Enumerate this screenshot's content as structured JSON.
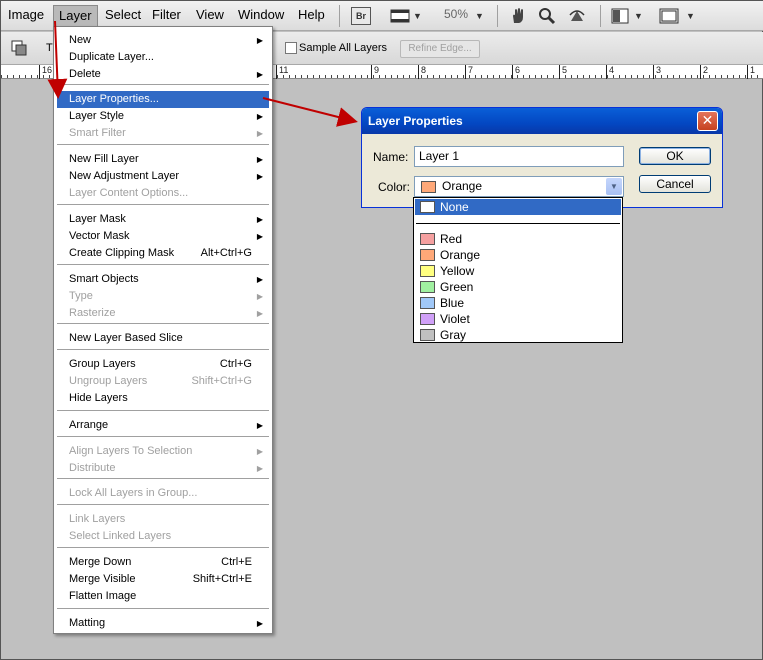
{
  "menubar": {
    "items": [
      "Image",
      "Layer",
      "Select",
      "Filter",
      "View",
      "Window",
      "Help"
    ],
    "br_label": "Br",
    "zoom": "50%"
  },
  "options_bar": {
    "t_label": "T",
    "sample_all_layers": "Sample All Layers",
    "refine_edge": "Refine Edge..."
  },
  "ruler": {
    "ticks": [
      "16",
      "11",
      "9",
      "8",
      "7",
      "6",
      "5",
      "4",
      "3",
      "2",
      "1"
    ]
  },
  "layer_menu": {
    "items": [
      {
        "label": "New",
        "shortcut": "",
        "submenu": true,
        "disabled": false
      },
      {
        "label": "Duplicate Layer...",
        "shortcut": "",
        "submenu": false,
        "disabled": false
      },
      {
        "label": "Delete",
        "shortcut": "",
        "submenu": true,
        "disabled": false
      },
      {
        "label": "Layer Properties...",
        "shortcut": "",
        "submenu": false,
        "disabled": false,
        "highlight": true
      },
      {
        "label": "Layer Style",
        "shortcut": "",
        "submenu": true,
        "disabled": false
      },
      {
        "label": "Smart Filter",
        "shortcut": "",
        "submenu": true,
        "disabled": true
      },
      {
        "label": "New Fill Layer",
        "shortcut": "",
        "submenu": true,
        "disabled": false
      },
      {
        "label": "New Adjustment Layer",
        "shortcut": "",
        "submenu": true,
        "disabled": false
      },
      {
        "label": "Layer Content Options...",
        "shortcut": "",
        "submenu": false,
        "disabled": true
      },
      {
        "label": "Layer Mask",
        "shortcut": "",
        "submenu": true,
        "disabled": false
      },
      {
        "label": "Vector Mask",
        "shortcut": "",
        "submenu": true,
        "disabled": false
      },
      {
        "label": "Create Clipping Mask",
        "shortcut": "Alt+Ctrl+G",
        "submenu": false,
        "disabled": false
      },
      {
        "label": "Smart Objects",
        "shortcut": "",
        "submenu": true,
        "disabled": false
      },
      {
        "label": "Type",
        "shortcut": "",
        "submenu": true,
        "disabled": true
      },
      {
        "label": "Rasterize",
        "shortcut": "",
        "submenu": true,
        "disabled": true
      },
      {
        "label": "New Layer Based Slice",
        "shortcut": "",
        "submenu": false,
        "disabled": false
      },
      {
        "label": "Group Layers",
        "shortcut": "Ctrl+G",
        "submenu": false,
        "disabled": false
      },
      {
        "label": "Ungroup Layers",
        "shortcut": "Shift+Ctrl+G",
        "submenu": false,
        "disabled": true
      },
      {
        "label": "Hide Layers",
        "shortcut": "",
        "submenu": false,
        "disabled": false
      },
      {
        "label": "Arrange",
        "shortcut": "",
        "submenu": true,
        "disabled": false
      },
      {
        "label": "Align Layers To Selection",
        "shortcut": "",
        "submenu": true,
        "disabled": true
      },
      {
        "label": "Distribute",
        "shortcut": "",
        "submenu": true,
        "disabled": true
      },
      {
        "label": "Lock All Layers in Group...",
        "shortcut": "",
        "submenu": false,
        "disabled": true
      },
      {
        "label": "Link Layers",
        "shortcut": "",
        "submenu": false,
        "disabled": true
      },
      {
        "label": "Select Linked Layers",
        "shortcut": "",
        "submenu": false,
        "disabled": true
      },
      {
        "label": "Merge Down",
        "shortcut": "Ctrl+E",
        "submenu": false,
        "disabled": false
      },
      {
        "label": "Merge Visible",
        "shortcut": "Shift+Ctrl+E",
        "submenu": false,
        "disabled": false
      },
      {
        "label": "Flatten Image",
        "shortcut": "",
        "submenu": false,
        "disabled": false
      },
      {
        "label": "Matting",
        "shortcut": "",
        "submenu": true,
        "disabled": false
      }
    ]
  },
  "dialog": {
    "title": "Layer Properties",
    "name_label": "Name:",
    "name_value": "Layer 1",
    "color_label": "Color:",
    "color_value": "Orange",
    "ok": "OK",
    "cancel": "Cancel",
    "color_options": [
      {
        "label": "None",
        "swatch": "#ffffff",
        "selected": true
      },
      {
        "label": "Red",
        "swatch": "#f5a0a0"
      },
      {
        "label": "Orange",
        "swatch": "#ffa878"
      },
      {
        "label": "Yellow",
        "swatch": "#ffff80"
      },
      {
        "label": "Green",
        "swatch": "#a0f0a0"
      },
      {
        "label": "Blue",
        "swatch": "#a0c8f8"
      },
      {
        "label": "Violet",
        "swatch": "#d0a0f8"
      },
      {
        "label": "Gray",
        "swatch": "#c0c0c0"
      }
    ]
  },
  "colors": {
    "highlight": "#316ac5",
    "arrow": "#c00000",
    "workspace": "#c0c0c0"
  }
}
